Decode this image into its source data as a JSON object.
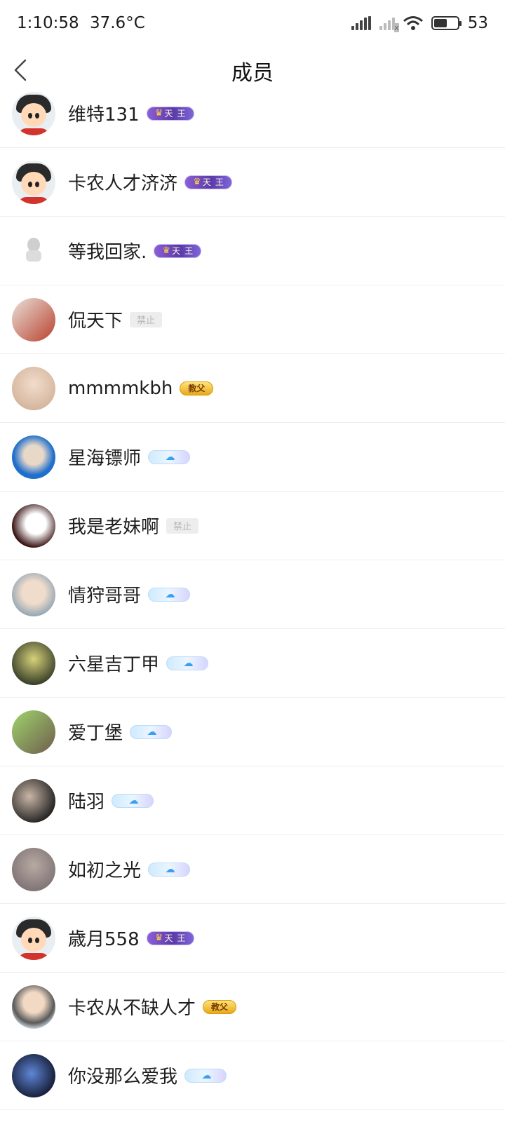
{
  "status_bar": {
    "time": "1:10:58",
    "temperature": "37.6°C",
    "battery_level": "53"
  },
  "header": {
    "title": "成员"
  },
  "members": [
    {
      "name": "维特131",
      "badge": "天王",
      "badge_type": "tianwang",
      "avatar": "cartoon-boy"
    },
    {
      "name": "卡农人才济济",
      "badge": "天王",
      "badge_type": "tianwang",
      "avatar": "cartoon-boy"
    },
    {
      "name": "等我回家.",
      "badge": "天王",
      "badge_type": "tianwang",
      "avatar": "small-figure"
    },
    {
      "name": "侃天下",
      "badge": "禁止",
      "badge_type": "jinzhi",
      "avatar": "basketball-player"
    },
    {
      "name": "mmmmkbh",
      "badge": "教父",
      "badge_type": "jiaofu",
      "avatar": "blonde-girl"
    },
    {
      "name": "星海镖师",
      "badge": "",
      "badge_type": "sky",
      "avatar": "man-glasses"
    },
    {
      "name": "我是老妹啊",
      "badge": "禁止",
      "badge_type": "jinzhi",
      "avatar": "panda"
    },
    {
      "name": "情狩哥哥",
      "badge": "",
      "badge_type": "sky",
      "avatar": "girl-portrait"
    },
    {
      "name": "六星吉丁甲",
      "badge": "",
      "badge_type": "sky",
      "avatar": "deer"
    },
    {
      "name": "爱丁堡",
      "badge": "",
      "badge_type": "sky",
      "avatar": "girl-headband"
    },
    {
      "name": "陆羽",
      "badge": "",
      "badge_type": "sky",
      "avatar": "cat-dark"
    },
    {
      "name": "如初之光",
      "badge": "",
      "badge_type": "sky",
      "avatar": "sunset-sky"
    },
    {
      "name": "歳月558",
      "badge": "天王",
      "badge_type": "tianwang",
      "avatar": "cartoon-boy"
    },
    {
      "name": "卡农从不缺人才",
      "badge": "教父",
      "badge_type": "jiaofu",
      "avatar": "masked-boy"
    },
    {
      "name": "你没那么爱我",
      "badge": "",
      "badge_type": "sky",
      "avatar": "dark-room"
    }
  ],
  "colors": {
    "background": "#ffffff",
    "divider": "#eeeeee",
    "tianwang_badge": "#5b3aa8",
    "jiaofu_badge": "#e7a91b",
    "jinzhi_badge": "#ededed",
    "sky_badge": "#cfeaff"
  }
}
